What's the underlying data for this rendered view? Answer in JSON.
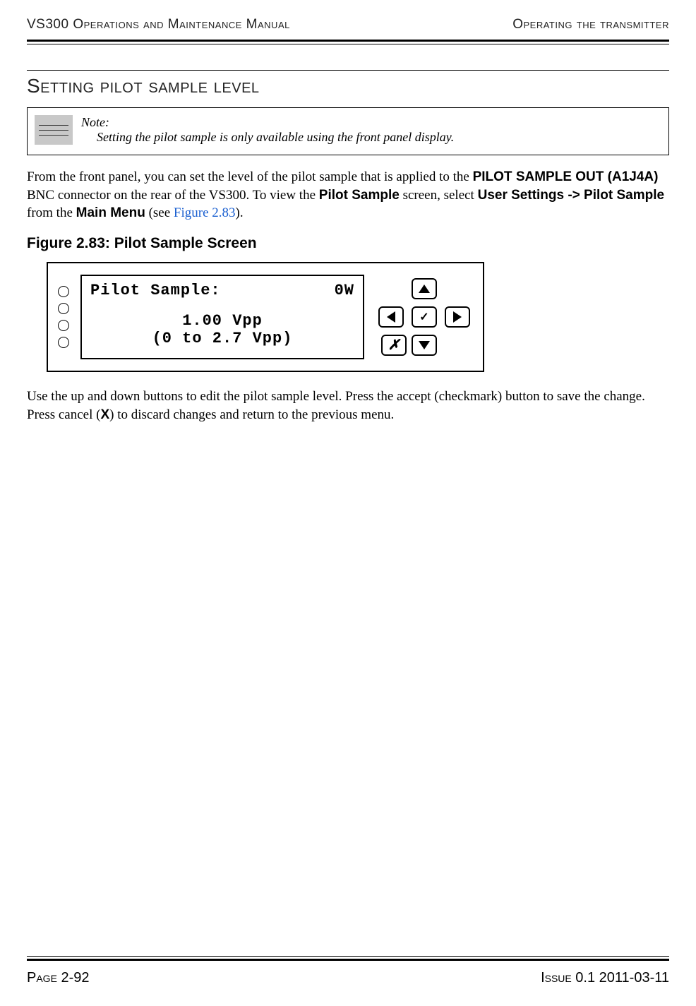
{
  "header": {
    "left": "VS300 Operations and Maintenance Manual",
    "right": "Operating the transmitter"
  },
  "section": {
    "title": "Setting pilot sample level"
  },
  "note": {
    "label": "Note:",
    "body": "Setting the pilot sample is only available using the front panel display."
  },
  "para1": {
    "t1": "From the front panel, you can set the level of the pilot sample that is applied to the ",
    "b1": "PILOT SAMPLE OUT (A1J4A)",
    "t2": " BNC connector on the rear of the VS300. To view the ",
    "b2": "Pilot Sample",
    "t3": " screen, select ",
    "b3": "User Settings -> Pilot Sample",
    "t4": " from the ",
    "b4": "Main Menu",
    "t5": " (see ",
    "link": "Figure 2.83",
    "t6": ")."
  },
  "figure": {
    "caption": "Figure 2.83: Pilot Sample Screen",
    "lcd": {
      "title": "Pilot Sample:",
      "value_w": "0W",
      "value_vpp": "1.00 Vpp",
      "range": "(0 to 2.7 Vpp)"
    },
    "dpad": {
      "ok": "✓",
      "cancel": "✗"
    }
  },
  "para2": {
    "t1": "Use the up and down buttons to edit the pilot sample level. Press the accept (checkmark) button to save the change. Press cancel (",
    "b1": "X",
    "t2": ") to discard changes and return to the previous menu."
  },
  "footer": {
    "left": "Page 2-92",
    "right": "Issue 0.1  2011-03-11"
  }
}
